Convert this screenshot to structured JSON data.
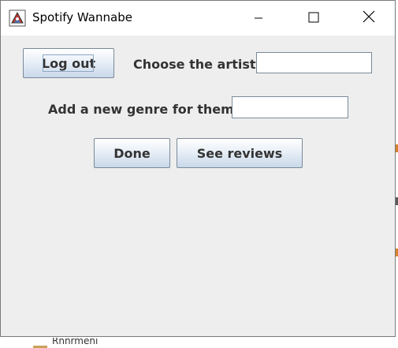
{
  "window": {
    "title": "Spotify Wannabe",
    "app_icon": "java-app-icon",
    "controls": {
      "minimize_icon": "minimize-icon",
      "maximize_icon": "maximize-icon",
      "close_icon": "close-icon"
    }
  },
  "form": {
    "logout_label": "Log out",
    "artist_label": "Choose the artist",
    "artist_value": "",
    "genre_label": "Add a new genre for them",
    "genre_value": "",
    "done_label": "Done",
    "reviews_label": "See reviews"
  },
  "background": {
    "partial_text": "Rnnrmeni"
  },
  "colors": {
    "button_border": "#7a8a99",
    "panel_bg": "#eeeeee",
    "text": "#333333"
  }
}
